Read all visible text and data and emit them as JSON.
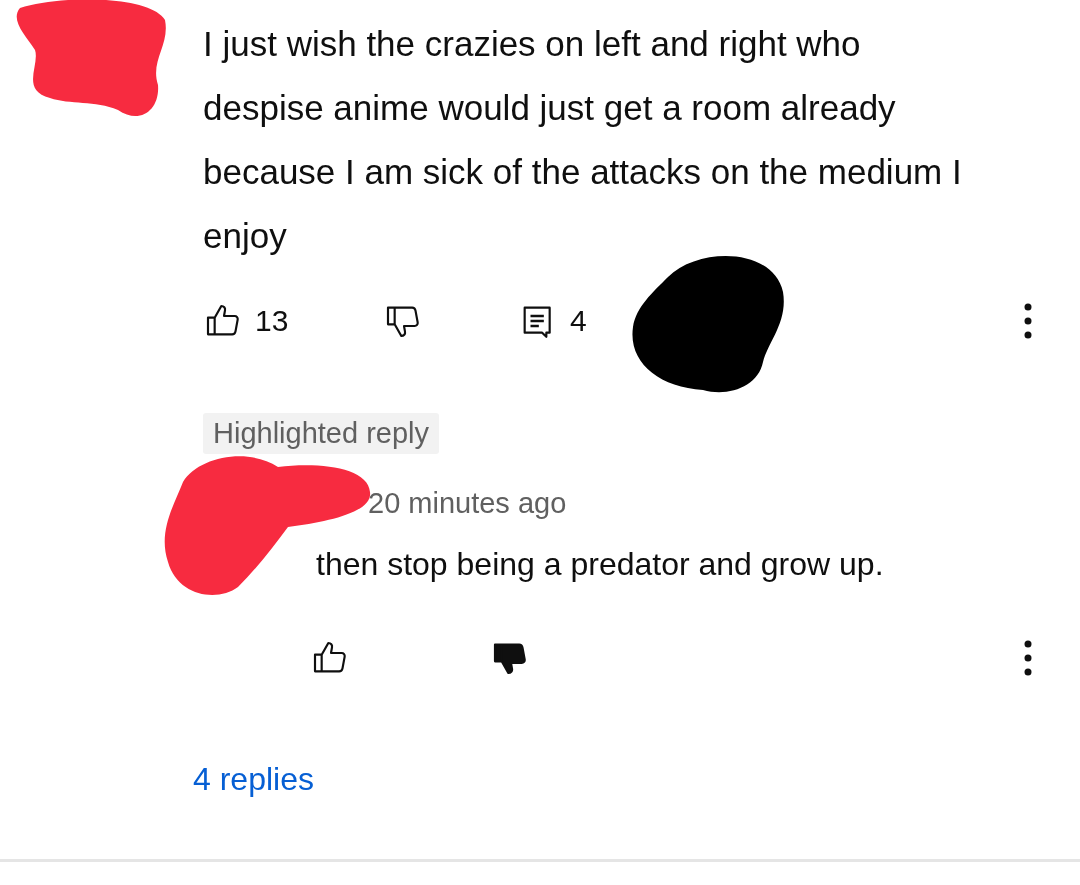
{
  "comment": {
    "text": "I just wish the crazies on left and right who despise anime would just get a room already because I am sick of the attacks on the medium I enjoy",
    "actions": {
      "like": {
        "count": "13",
        "selected": false
      },
      "dislike": {
        "selected": false
      },
      "replies": {
        "count": "4"
      }
    }
  },
  "highlighted_reply": {
    "badge": "Highlighted reply",
    "time": "20 minutes ago",
    "text": "then stop being a predator and grow up.",
    "actions": {
      "like": {
        "selected": false
      },
      "dislike": {
        "selected": true
      }
    }
  },
  "more_replies": "4 replies"
}
